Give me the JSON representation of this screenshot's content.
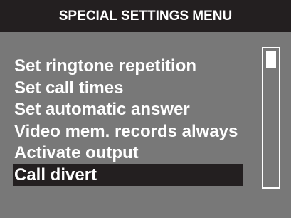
{
  "header": {
    "title": "SPECIAL SETTINGS MENU"
  },
  "menu": {
    "items": [
      {
        "label": "Set ringtone repetition"
      },
      {
        "label": "Set call times"
      },
      {
        "label": "Set automatic answer"
      },
      {
        "label": "Video mem. records always"
      },
      {
        "label": "Activate output"
      },
      {
        "label": "Call divert"
      }
    ],
    "selected_label": "Call divert"
  },
  "colors": {
    "background": "#787878",
    "header_background": "#231f20",
    "highlight_background": "#231f20",
    "text": "#ffffff"
  }
}
